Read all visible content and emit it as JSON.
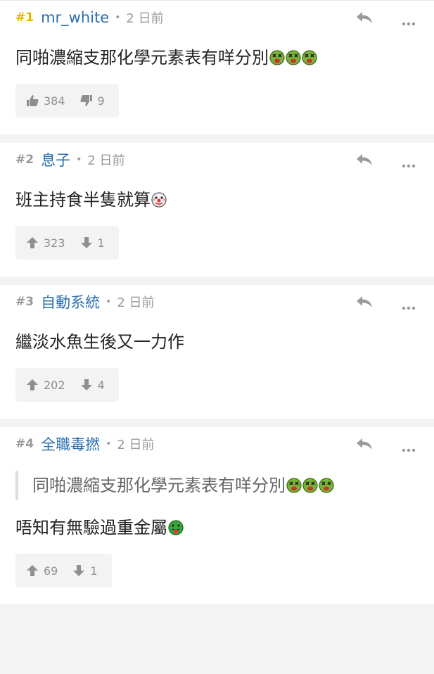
{
  "posts": [
    {
      "floor": "#1",
      "username": "mr_white",
      "time": "2 日前",
      "content": "同啪濃縮支那化學元素表有咩分別",
      "emojis": [
        "sick-emoji",
        "sick-emoji",
        "sick-emoji"
      ],
      "vote_style": "thumbs",
      "upvotes": "384",
      "downvotes": "9"
    },
    {
      "floor": "#2",
      "username": "息子",
      "time": "2 日前",
      "content": "班主持食半隻就算",
      "emojis": [
        "clown-emoji"
      ],
      "vote_style": "arrows",
      "upvotes": "323",
      "downvotes": "1"
    },
    {
      "floor": "#3",
      "username": "自動系統",
      "time": "2 日前",
      "content": "繼淡水魚生後又一力作",
      "emojis": [],
      "vote_style": "arrows",
      "upvotes": "202",
      "downvotes": "4"
    },
    {
      "floor": "#4",
      "username": "全職毒撚",
      "time": "2 日前",
      "quote": "同啪濃縮支那化學元素表有咩分別",
      "quote_emojis": [
        "sick-emoji",
        "sick-emoji",
        "sick-emoji"
      ],
      "content": "唔知有無驗過重金屬",
      "emojis": [
        "tongue-emoji"
      ],
      "vote_style": "arrows",
      "upvotes": "69",
      "downvotes": "1"
    }
  ],
  "separator": "•",
  "colors": {
    "username": "#2a6fae",
    "first_floor": "#e8b400",
    "muted": "#9a9a9a"
  }
}
